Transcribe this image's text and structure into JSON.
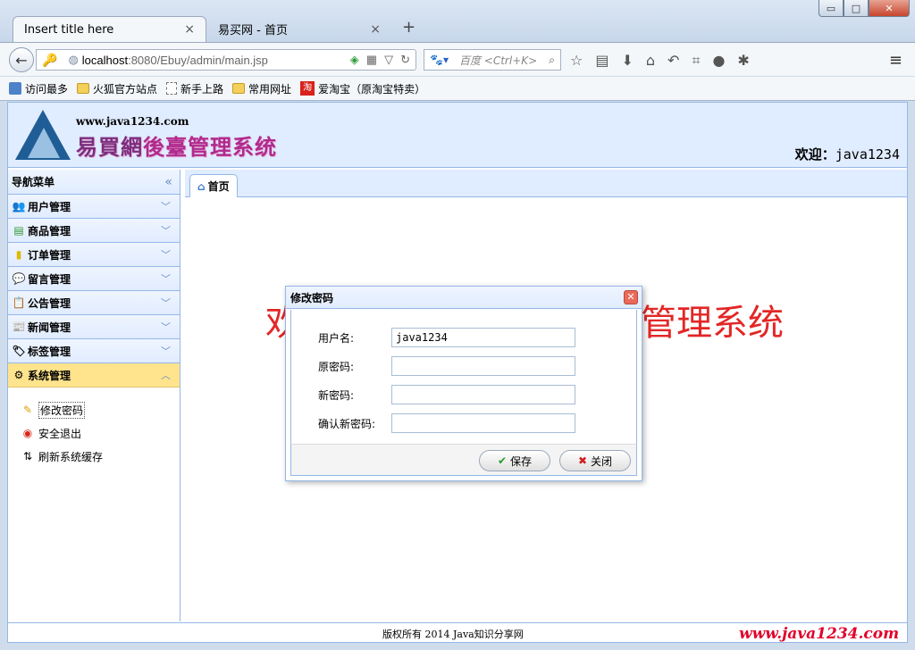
{
  "browser": {
    "tabs": [
      {
        "label": "Insert title here",
        "close": "×"
      },
      {
        "label": "易买网 - 首页",
        "close": "×"
      }
    ],
    "new_tab": "+",
    "window_buttons": {
      "minimize": "▭",
      "maximize": "□",
      "close": "✕"
    },
    "url_host": "localhost",
    "url_path": ":8080/Ebuy/admin/main.jsp",
    "search_placeholder": "百度 <Ctrl+K>",
    "bookmarks": [
      "访问最多",
      "火狐官方站点",
      "新手上路",
      "常用网址",
      "爱淘宝（原淘宝特卖）"
    ],
    "taobao_glyph": "淘"
  },
  "header": {
    "site": "www.java1234.com",
    "title_part1": "易買網",
    "title_part2": "後臺管理系统",
    "welcome_label": "欢迎：",
    "username": "java1234"
  },
  "sidebar": {
    "title": "导航菜单",
    "menus": [
      {
        "label": "用户管理",
        "icon": "👥"
      },
      {
        "label": "商品管理",
        "icon": "▤"
      },
      {
        "label": "订单管理",
        "icon": "▮"
      },
      {
        "label": "留言管理",
        "icon": "💬"
      },
      {
        "label": "公告管理",
        "icon": "📋"
      },
      {
        "label": "新闻管理",
        "icon": "📰"
      },
      {
        "label": "标签管理",
        "icon": "🏷"
      },
      {
        "label": "系统管理",
        "icon": "⚙"
      }
    ],
    "system_items": [
      {
        "label": "修改密码",
        "icon": "✎"
      },
      {
        "label": "安全退出",
        "icon": "◉"
      },
      {
        "label": "刷新系统缓存",
        "icon": "⇅"
      }
    ]
  },
  "main": {
    "tab_label": "首页",
    "welcome_text_visible_left": "欢",
    "welcome_text_visible_right": "管理系统"
  },
  "dialog": {
    "title": "修改密码",
    "fields": [
      {
        "label": "用户名:",
        "value": "java1234"
      },
      {
        "label": "原密码:",
        "value": ""
      },
      {
        "label": "新密码:",
        "value": ""
      },
      {
        "label": "确认新密码:",
        "value": ""
      }
    ],
    "save_label": "保存",
    "close_label": "关闭"
  },
  "footer": {
    "copyright": "版权所有 2014 Java知识分享网",
    "watermark": "www.java1234.com"
  },
  "colors": {
    "accent_blue": "#95b8e7",
    "header_bg": "#e0ecff",
    "active_menu": "#ffe48d",
    "welcome_red": "#e32626"
  }
}
